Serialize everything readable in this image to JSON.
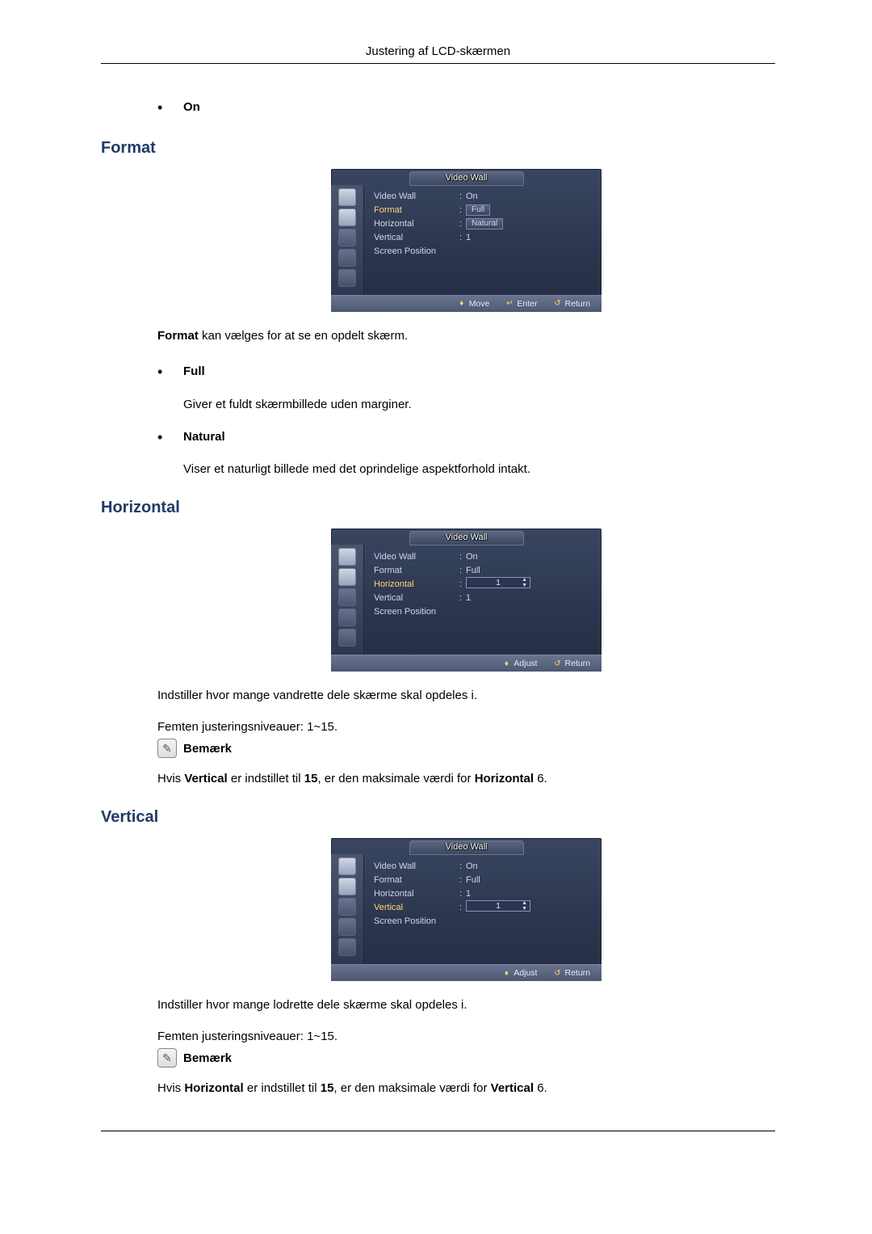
{
  "header": {
    "title": "Justering af LCD-skærmen"
  },
  "on_bullet": {
    "label": "On"
  },
  "format_section": {
    "heading": "Format",
    "osd_title": "Video Wall",
    "rows": [
      {
        "label": "Video Wall",
        "value": "On"
      },
      {
        "label": "Format",
        "value": "Full",
        "pill": true
      },
      {
        "label": "Horizontal",
        "value": "Natural"
      },
      {
        "label": "Vertical",
        "value": "1"
      },
      {
        "label": "Screen Position",
        "value": ""
      }
    ],
    "footer": {
      "a": "Move",
      "b": "Enter",
      "c": "Return"
    },
    "intro_inline_bold": "Format",
    "intro_rest": " kan vælges for at se en opdelt skærm.",
    "full": {
      "label": "Full",
      "desc": "Giver et fuldt skærmbillede uden marginer."
    },
    "natural": {
      "label": "Natural",
      "desc": "Viser et naturligt billede med det oprindelige aspektforhold intakt."
    }
  },
  "horizontal_section": {
    "heading": "Horizontal",
    "osd_title": "Video Wall",
    "rows": [
      {
        "label": "Video Wall",
        "value": "On"
      },
      {
        "label": "Format",
        "value": "Full"
      },
      {
        "label": "Horizontal",
        "value": "1",
        "slider": true
      },
      {
        "label": "Vertical",
        "value": "1"
      },
      {
        "label": "Screen Position",
        "value": ""
      }
    ],
    "footer": {
      "a": "Adjust",
      "c": "Return"
    },
    "desc": "Indstiller hvor mange vandrette dele skærme skal opdeles i.",
    "levels": "Femten justeringsniveauer: 1~15.",
    "note_label": "Bemærk",
    "note_text_pre": "Hvis ",
    "note_bold1": "Vertical",
    "note_text_mid": " er indstillet til ",
    "note_bold2": "15",
    "note_text_mid2": ", er den maksimale værdi for ",
    "note_bold3": "Horizontal",
    "note_text_post": " 6."
  },
  "vertical_section": {
    "heading": "Vertical",
    "osd_title": "Video Wall",
    "rows": [
      {
        "label": "Video Wall",
        "value": "On"
      },
      {
        "label": "Format",
        "value": "Full"
      },
      {
        "label": "Horizontal",
        "value": "1"
      },
      {
        "label": "Vertical",
        "value": "1",
        "slider": true
      },
      {
        "label": "Screen Position",
        "value": ""
      }
    ],
    "footer": {
      "a": "Adjust",
      "c": "Return"
    },
    "desc": "Indstiller hvor mange lodrette dele skærme skal opdeles i.",
    "levels": "Femten justeringsniveauer: 1~15.",
    "note_label": "Bemærk",
    "note_text_pre": "Hvis ",
    "note_bold1": "Horizontal",
    "note_text_mid": " er indstillet til ",
    "note_bold2": "15",
    "note_text_mid2": ", er den maksimale værdi for ",
    "note_bold3": "Vertical",
    "note_text_post": " 6."
  }
}
